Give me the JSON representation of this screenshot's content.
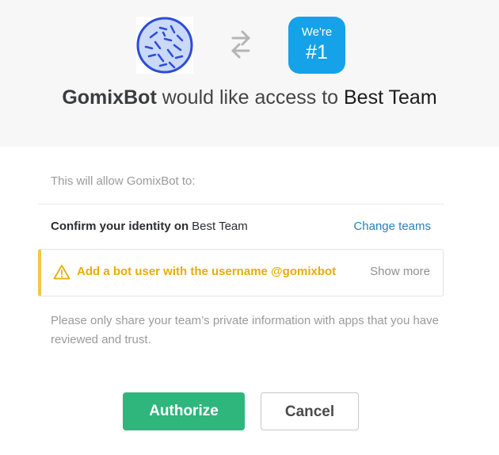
{
  "header": {
    "team_icon": {
      "line1": "We're",
      "line2": "#1",
      "color": "#16a2e8"
    },
    "title": {
      "app_name": "GomixBot",
      "middle": " would like access to ",
      "team_name": "Best Team"
    }
  },
  "permissions": {
    "allow_text": "This will allow GomixBot to:",
    "identity": {
      "label": "Confirm your identity on",
      "team": "Best Team",
      "change_link": "Change teams"
    },
    "warning": {
      "text": "Add a bot user with the username @gomixbot",
      "show_more": "Show more",
      "color": "#e8ab0a"
    },
    "note": "Please only share your team’s private information with apps that you have reviewed and trust."
  },
  "actions": {
    "authorize_label": "Authorize",
    "cancel_label": "Cancel",
    "authorize_color": "#2eb67d"
  },
  "icons": [
    "app-avatar-icon",
    "swap-arrows-icon",
    "warning-icon"
  ]
}
